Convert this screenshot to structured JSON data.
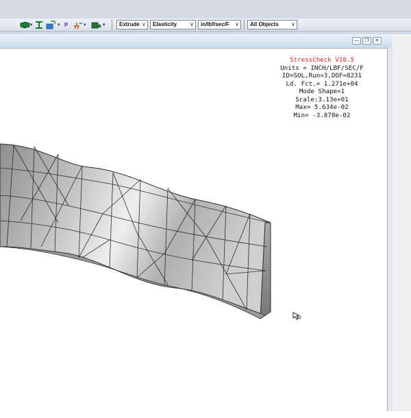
{
  "toolbar": {
    "icons": [
      "cube-icon",
      "dimension-icon",
      "load-icon",
      "parameter-icon",
      "constraint-icon",
      "mesh-icon"
    ],
    "parameter_label": "P",
    "combos": [
      {
        "name": "extrude-select",
        "value": "Extrude"
      },
      {
        "name": "analysis-select",
        "value": "Elasticity"
      },
      {
        "name": "units-select",
        "value": "in/lbf/sec/F"
      },
      {
        "name": "objects-select",
        "value": "All Objects"
      }
    ],
    "dropdown_arrow": "∨"
  },
  "window": {
    "controls": [
      "minimize-icon",
      "restore-icon",
      "close-icon"
    ],
    "minimize": "—",
    "restore": "❐",
    "close": "✕"
  },
  "info": {
    "title": "StressCheck V10.5",
    "lines": [
      "Units = INCH/LBF/SEC/F",
      "ID=SOL,Run=3,DOF=8231",
      "Ld. Fct.=  1.271e+04",
      "Mode Shape=1",
      "Scale:3.13e+01",
      "Max=  5.634e-02",
      "Min= -3.878e-02"
    ]
  },
  "colors": {
    "mesh_fill": "#b3b3b3",
    "mesh_edge": "#2a2a2a",
    "title_red": "#d6242b"
  }
}
